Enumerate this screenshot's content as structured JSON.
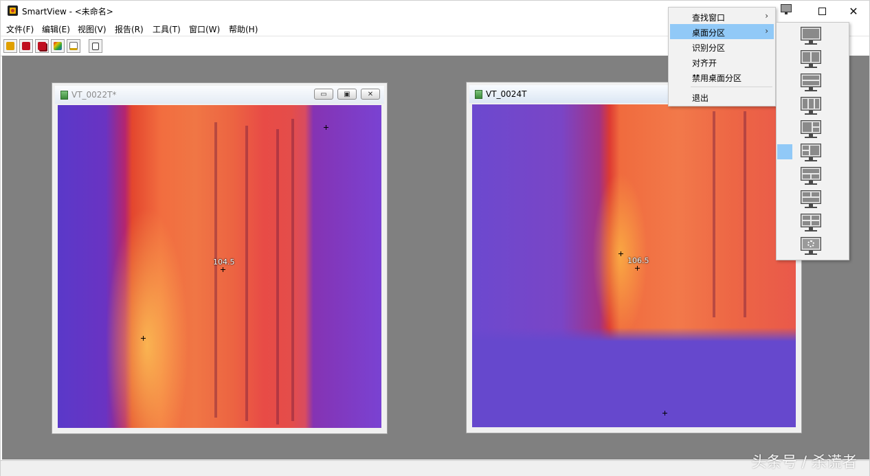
{
  "app": {
    "title": "SmartView - <未命名>"
  },
  "menubar": {
    "items": [
      {
        "label": "文件(F)"
      },
      {
        "label": "编辑(E)"
      },
      {
        "label": "视图(V)"
      },
      {
        "label": "报告(R)"
      },
      {
        "label": "工具(T)"
      },
      {
        "label": "窗口(W)"
      },
      {
        "label": "帮助(H)"
      }
    ]
  },
  "toolbar": {
    "buttons": [
      {
        "icon": "open-folder-icon",
        "color": "#e0a000"
      },
      {
        "icon": "save-icon",
        "color": "#c01020"
      },
      {
        "icon": "save-all-icon",
        "color": "#c01020"
      },
      {
        "icon": "color-palette-icon",
        "color": "#3060c0"
      },
      {
        "icon": "edit-pencil-icon",
        "color": "#d0a000"
      },
      {
        "icon": "print-icon",
        "color": "#333333"
      }
    ]
  },
  "windows": [
    {
      "title": "VT_0022T*",
      "state": "inactive",
      "markers": [
        {
          "label": "104.5",
          "kind": "center"
        },
        {
          "label": "",
          "kind": "hot"
        },
        {
          "label": "",
          "kind": "cold"
        }
      ]
    },
    {
      "title": "VT_0024T",
      "state": "active",
      "markers": [
        {
          "label": "106.5",
          "kind": "center"
        },
        {
          "label": "",
          "kind": "hot"
        },
        {
          "label": "",
          "kind": "cold"
        }
      ]
    }
  ],
  "context_menu": {
    "items": [
      {
        "label": "查找窗口",
        "has_submenu": true,
        "highlighted": false
      },
      {
        "label": "桌面分区",
        "has_submenu": true,
        "highlighted": true
      },
      {
        "label": "识别分区",
        "has_submenu": false,
        "highlighted": false
      },
      {
        "label": "对齐开",
        "has_submenu": false,
        "highlighted": false
      },
      {
        "label": "禁用桌面分区",
        "has_submenu": false,
        "highlighted": false
      },
      {
        "label": "退出",
        "has_submenu": false,
        "highlighted": false
      }
    ],
    "submenu_arrow": "›"
  },
  "desktop_partition_submenu": {
    "layouts": [
      "full",
      "two-columns",
      "two-rows",
      "three-columns",
      "left-wide-right-split",
      "left-split-right-wide",
      "top-wide-bottom-split",
      "top-split-bottom-wide",
      "four-quadrants",
      "custom"
    ]
  },
  "watermark": "头条号 / 杀谎者",
  "colors": {
    "highlight": "#91c9f7",
    "mdi_background": "#808080"
  }
}
